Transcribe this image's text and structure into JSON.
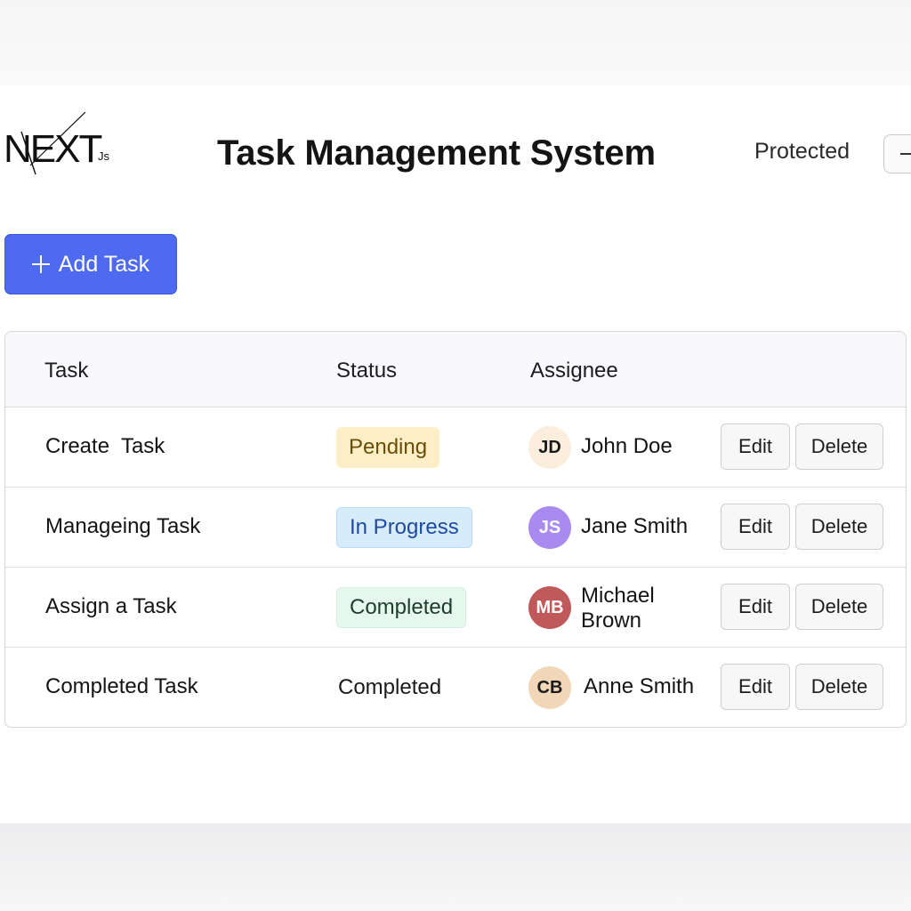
{
  "header": {
    "logo_text": "NEXT",
    "logo_sub": "Js",
    "title": "Task Management System",
    "protected_label": "Protected"
  },
  "toolbar": {
    "add_task_label": "Add Task"
  },
  "table": {
    "columns": [
      "Task",
      "Status",
      "Assignee"
    ],
    "rows": [
      {
        "task": "Create  Task",
        "status": "Pending",
        "assignee": "John Doe",
        "initials": "JD",
        "edit_label": "Edit",
        "delete_label": "Delete"
      },
      {
        "task": "Manageing Task",
        "status": "In Progress",
        "assignee": "Jane Smith",
        "initials": "JS",
        "edit_label": "Edit",
        "delete_label": "Delete"
      },
      {
        "task": "Assign a Task",
        "status": "Completed",
        "assignee": "Michael Brown",
        "initials": "MB",
        "edit_label": "Edit",
        "delete_label": "Delete"
      },
      {
        "task": "Completed Task",
        "status": "Completed",
        "assignee": "Anne Smith",
        "initials": "CB",
        "edit_label": "Edit",
        "delete_label": "Delete"
      }
    ]
  },
  "colors": {
    "primary_button": "#4d6af0",
    "pending_bg": "#fcefc7",
    "pending_text": "#6b4e06",
    "in_progress_bg": "#d7ecfb",
    "in_progress_text": "#1f4aa0",
    "completed_bg": "#e6f8ee",
    "completed_text": "#1d3d2a",
    "avatar_jd": "#fbeedd",
    "avatar_js": "#a98bef",
    "avatar_mb": "#c05a5a",
    "avatar_cb": "#f1d7b8"
  }
}
